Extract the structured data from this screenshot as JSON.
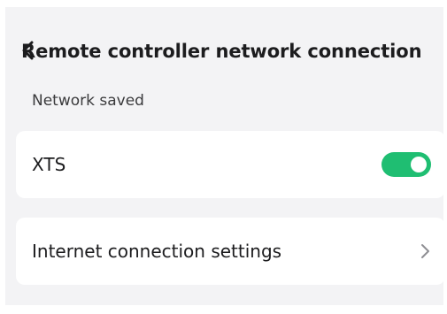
{
  "header": {
    "title": "Remote controller network connection",
    "back_icon": "back-arrow-icon"
  },
  "section": {
    "label": "Network saved"
  },
  "networks": [
    {
      "name": "XTS",
      "toggle_on": true
    }
  ],
  "settings_item": {
    "label": "Internet connection settings",
    "icon": "chevron-right-icon"
  },
  "colors": {
    "accent": "#1fbe72",
    "background": "#f3f3f5",
    "card": "#ffffff"
  }
}
